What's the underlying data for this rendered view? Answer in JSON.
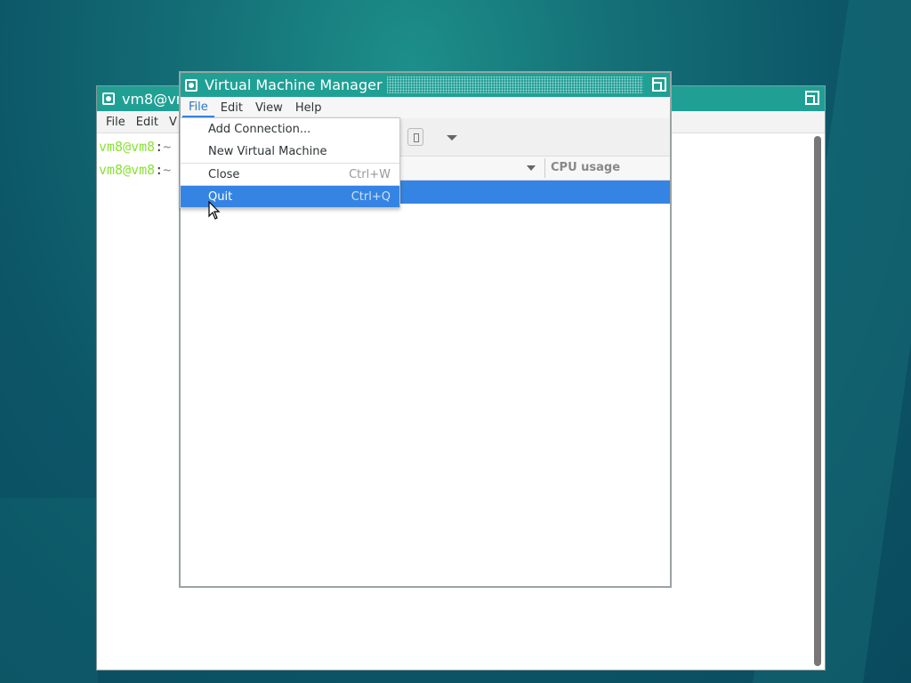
{
  "terminal": {
    "title": "vm8@vm8",
    "menu": [
      "File",
      "Edit",
      "V"
    ],
    "lines": [
      {
        "prompt": "vm8@vm8",
        "sep": ":",
        "path": "~"
      },
      {
        "prompt": "vm8@vm8",
        "sep": ":",
        "path": "~"
      }
    ]
  },
  "vmm": {
    "title": "Virtual Machine Manager",
    "menu": [
      "File",
      "Edit",
      "View",
      "Help"
    ],
    "column_cpu": "CPU usage"
  },
  "file_menu": {
    "items": [
      {
        "label": "Add Connection...",
        "accel": ""
      },
      {
        "label": "New Virtual Machine",
        "accel": ""
      },
      {
        "label": "Close",
        "accel": "Ctrl+W"
      },
      {
        "label": "Quit",
        "accel": "Ctrl+Q"
      }
    ]
  }
}
